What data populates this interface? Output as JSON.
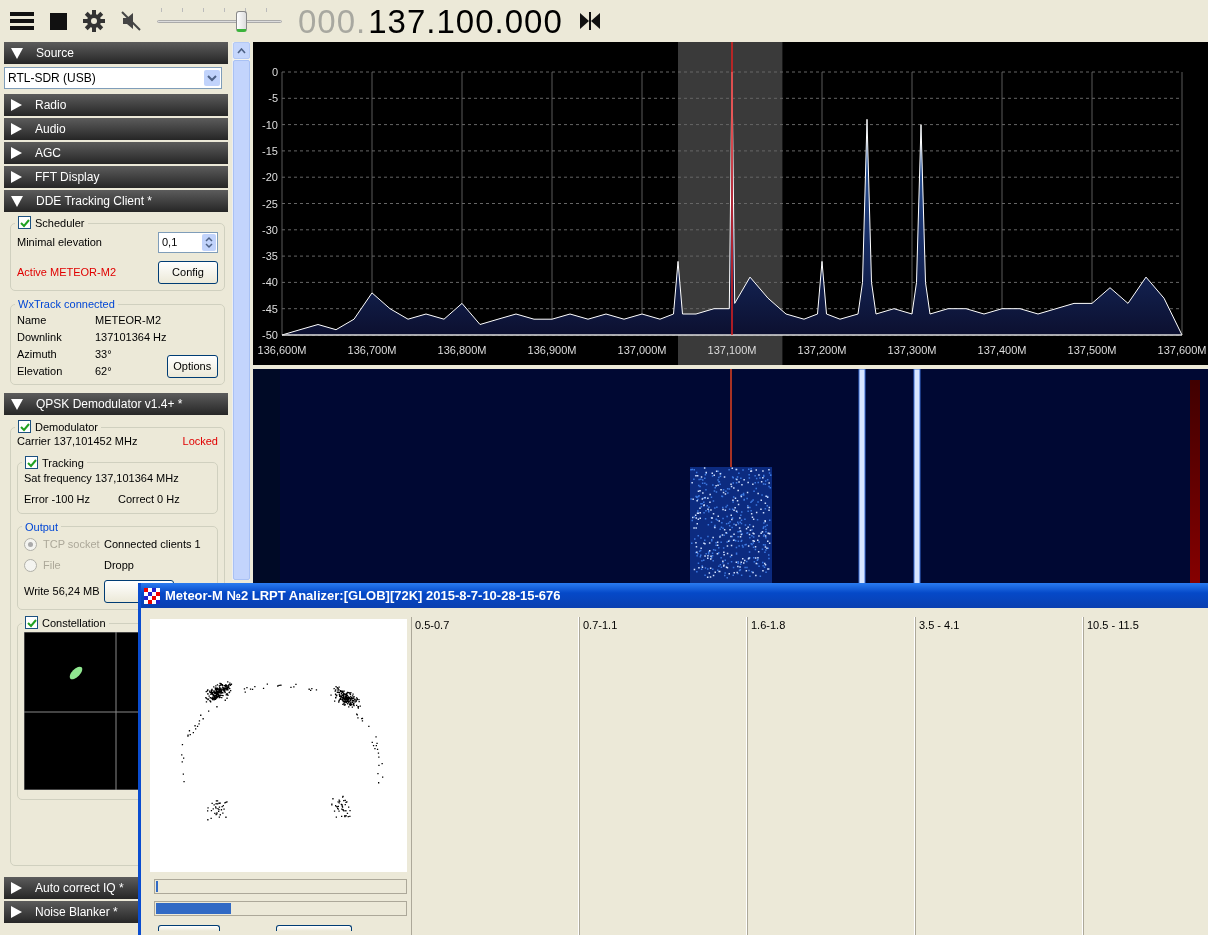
{
  "toolbar": {
    "muted": true,
    "volume": {
      "level": 0.67
    },
    "frequency_prefix": "000.",
    "frequency": "137.100.000"
  },
  "sidebar": {
    "sections": [
      {
        "title": "Source",
        "expanded": true,
        "kind": "source",
        "device": "RTL-SDR (USB)"
      },
      {
        "title": "Radio",
        "expanded": false
      },
      {
        "title": "Audio",
        "expanded": false
      },
      {
        "title": "AGC",
        "expanded": false
      },
      {
        "title": "FFT Display",
        "expanded": false
      },
      {
        "title": "DDE Tracking Client *",
        "expanded": true,
        "kind": "dde",
        "scheduler": {
          "label": "Scheduler",
          "checked": true,
          "elevation_label": "Minimal elevation",
          "elevation_value": "0,1",
          "status": "Active METEOR-M2",
          "button": "Config"
        },
        "tracker": {
          "title": "WxTrack connected",
          "fields": [
            {
              "label": "Name",
              "value": "METEOR-M2"
            },
            {
              "label": "Downlink",
              "value": "137101364 Hz"
            },
            {
              "label": "Azimuth",
              "value": "33°"
            },
            {
              "label": "Elevation",
              "value": "62°"
            }
          ],
          "button": "Options"
        }
      },
      {
        "title": "QPSK Demodulator v1.4+ *",
        "expanded": true,
        "kind": "qpsk",
        "demodulator": {
          "label": "Demodulator",
          "checked": true,
          "carrier": "Carrier 137,101452 MHz",
          "status": "Locked"
        },
        "tracking": {
          "label": "Tracking",
          "checked": true,
          "sat_frequency": "Sat frequency 137,101364 MHz",
          "error": "Error -100 Hz",
          "correct": "Correct 0 Hz"
        },
        "output": {
          "title": "Output",
          "options": [
            {
              "label": "TCP socket",
              "selected": true,
              "disabled": true,
              "info": "Connected clients 1"
            },
            {
              "label": "File",
              "selected": false,
              "disabled": true,
              "info": "Dropp"
            }
          ],
          "write": "Write 56,24 MB"
        },
        "constellation": {
          "label": "Constellation",
          "checked": true
        }
      },
      {
        "title": "Auto correct IQ *",
        "expanded": false
      },
      {
        "title": "Noise Blanker *",
        "expanded": false
      }
    ]
  },
  "spectrum": {
    "chart_data": {
      "type": "area",
      "xlim": [
        136600,
        137600
      ],
      "ylim": [
        -50,
        0
      ],
      "grid": true,
      "bands": [
        {
          "axis": "x",
          "from": 137040,
          "to": 137156
        }
      ],
      "ref_lines": [
        {
          "axis": "x",
          "value": 137100,
          "color": "#e02020"
        }
      ],
      "xticks": [
        {
          "value": 136600,
          "label": "136,600M"
        },
        {
          "value": 136700,
          "label": "136,700M"
        },
        {
          "value": 136800,
          "label": "136,800M"
        },
        {
          "value": 136900,
          "label": "136,900M"
        },
        {
          "value": 137000,
          "label": "137,000M"
        },
        {
          "value": 137100,
          "label": "137,100M"
        },
        {
          "value": 137200,
          "label": "137,200M"
        },
        {
          "value": 137300,
          "label": "137,300M"
        },
        {
          "value": 137400,
          "label": "137,400M"
        },
        {
          "value": 137500,
          "label": "137,500M"
        },
        {
          "value": 137600,
          "label": "137,600M"
        }
      ],
      "yticks": [
        0,
        -5,
        -10,
        -15,
        -20,
        -25,
        -30,
        -35,
        -40,
        -45,
        -50
      ],
      "x": [
        136600,
        136620,
        136640,
        136660,
        136680,
        136700,
        136720,
        136740,
        136760,
        136780,
        136800,
        136820,
        136840,
        136860,
        136880,
        136900,
        136920,
        136940,
        136960,
        136980,
        137000,
        137020,
        137035,
        137040,
        137045,
        137060,
        137080,
        137097,
        137100,
        137103,
        137120,
        137140,
        137160,
        137180,
        137195,
        137200,
        137205,
        137220,
        137240,
        137245,
        137250,
        137255,
        137260,
        137280,
        137300,
        137305,
        137310,
        137315,
        137320,
        137340,
        137360,
        137380,
        137400,
        137420,
        137440,
        137460,
        137480,
        137500,
        137520,
        137540,
        137560,
        137580,
        137600
      ],
      "series": [
        {
          "color": "#ffffff",
          "values": [
            -50,
            -49,
            -48,
            -49,
            -47,
            -42,
            -45,
            -47,
            -46,
            -47,
            -44,
            -48,
            -47,
            -46,
            -47,
            -47,
            -46,
            -47,
            -46,
            -47,
            -46,
            -47,
            -46,
            -36,
            -46,
            -46,
            -45,
            -45,
            0,
            -44,
            -39,
            -43,
            -46,
            -47,
            -46,
            -36,
            -46,
            -47,
            -46,
            -40,
            -9,
            -40,
            -46,
            -45,
            -46,
            -40,
            -10,
            -40,
            -46,
            -45,
            -45,
            -46,
            -45,
            -45,
            -46,
            -45,
            -44,
            -44,
            -41,
            -44,
            -39,
            -43,
            -50
          ]
        }
      ]
    }
  },
  "analyzer": {
    "title": "Meteor-M №2 LRPT Analizer:[GLOB][72K] 2015-8-7-10-28-15-676",
    "progress": [
      {
        "level": 0.01
      },
      {
        "level": 0.3
      }
    ],
    "channels": [
      "0.5-0.7",
      "0.7-1.1",
      "1.6-1.8",
      "3.5 - 4.1",
      "10.5 - 11.5"
    ]
  }
}
